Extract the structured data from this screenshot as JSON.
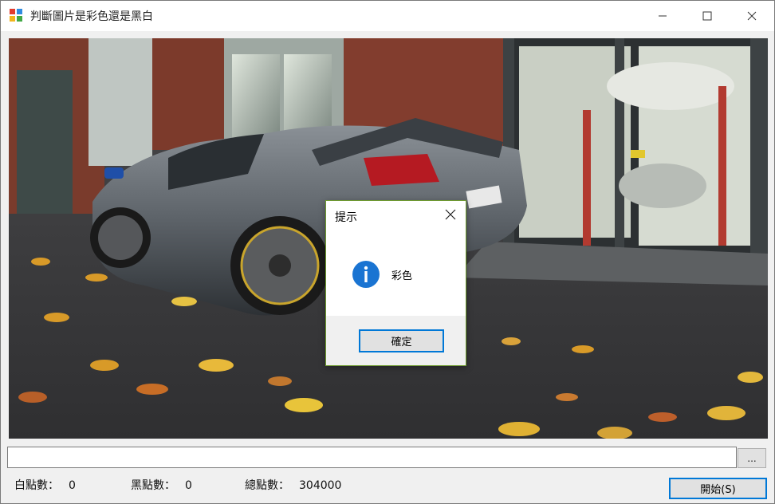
{
  "window": {
    "title": "判斷圖片是彩色還是黑白"
  },
  "controls": {
    "file_path_value": "",
    "browse_label": "...",
    "start_label": "開始(S)"
  },
  "stats": {
    "white_label": "白點數：",
    "white_value": "0",
    "black_label": "黑點數：",
    "black_value": "0",
    "total_label": "總點數：",
    "total_value": "304000"
  },
  "dialog": {
    "title": "提示",
    "message": "彩色",
    "ok_label": "確定",
    "icon": "information-icon"
  },
  "colors": {
    "accent": "#0078d7",
    "info_icon": "#1a74d2"
  }
}
